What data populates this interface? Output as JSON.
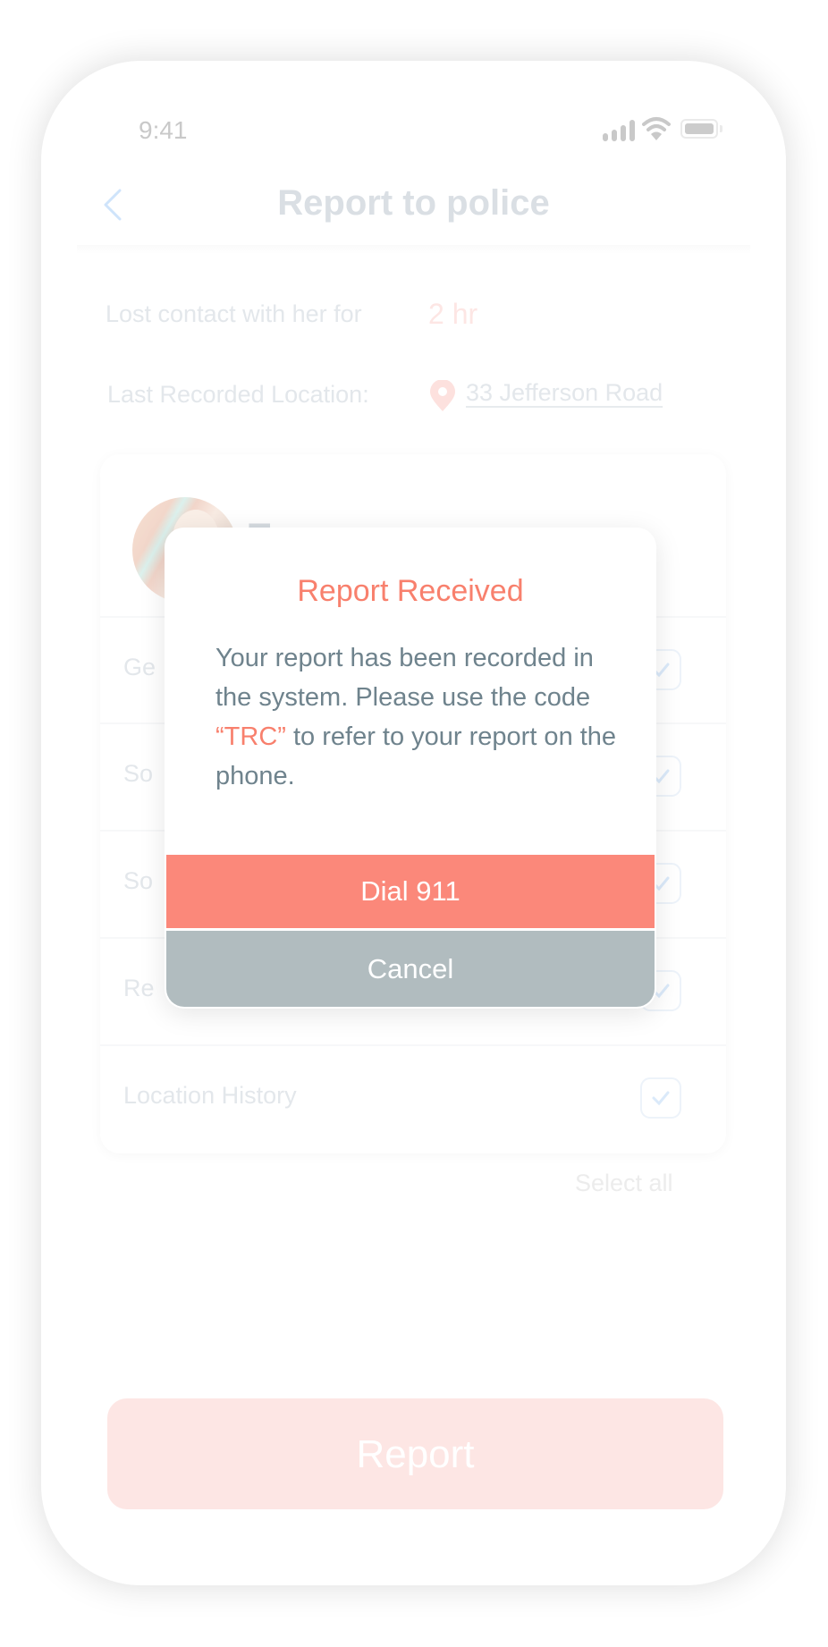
{
  "status_bar": {
    "time": "9:41",
    "icons": [
      "cellular-signal-icon",
      "wifi-icon",
      "battery-icon"
    ]
  },
  "nav": {
    "back_icon": "chevron-left-icon",
    "title": "Report to police"
  },
  "info": {
    "lost_contact_label": "Lost contact with her for",
    "lost_contact_value": "2 hr",
    "location_label": "Last Recorded Location:",
    "location_icon": "map-pin-icon",
    "location_value": "33 Jefferson Road"
  },
  "profile": {
    "name_visible_fragment": "T"
  },
  "data_items": [
    {
      "label": "Ge",
      "checked": true
    },
    {
      "label": "So",
      "checked": true
    },
    {
      "label": "So",
      "checked": true
    },
    {
      "label": "Re",
      "checked": true
    },
    {
      "label": "Location History",
      "checked": true
    }
  ],
  "select_all_label": "Select all",
  "report_button_label": "Report",
  "modal": {
    "title": "Report Received",
    "body_before_code": "Your report has been recorded in the system.  Please use the code ",
    "code": "“TRC”",
    "body_after_code": "  to refer to your report on the phone.",
    "primary_button": "Dial 911",
    "secondary_button": "Cancel"
  },
  "colors": {
    "accent": "#f8806d",
    "dial_button": "#fb887a",
    "cancel_button": "#b1bcbf",
    "body_text": "#6f838d"
  }
}
